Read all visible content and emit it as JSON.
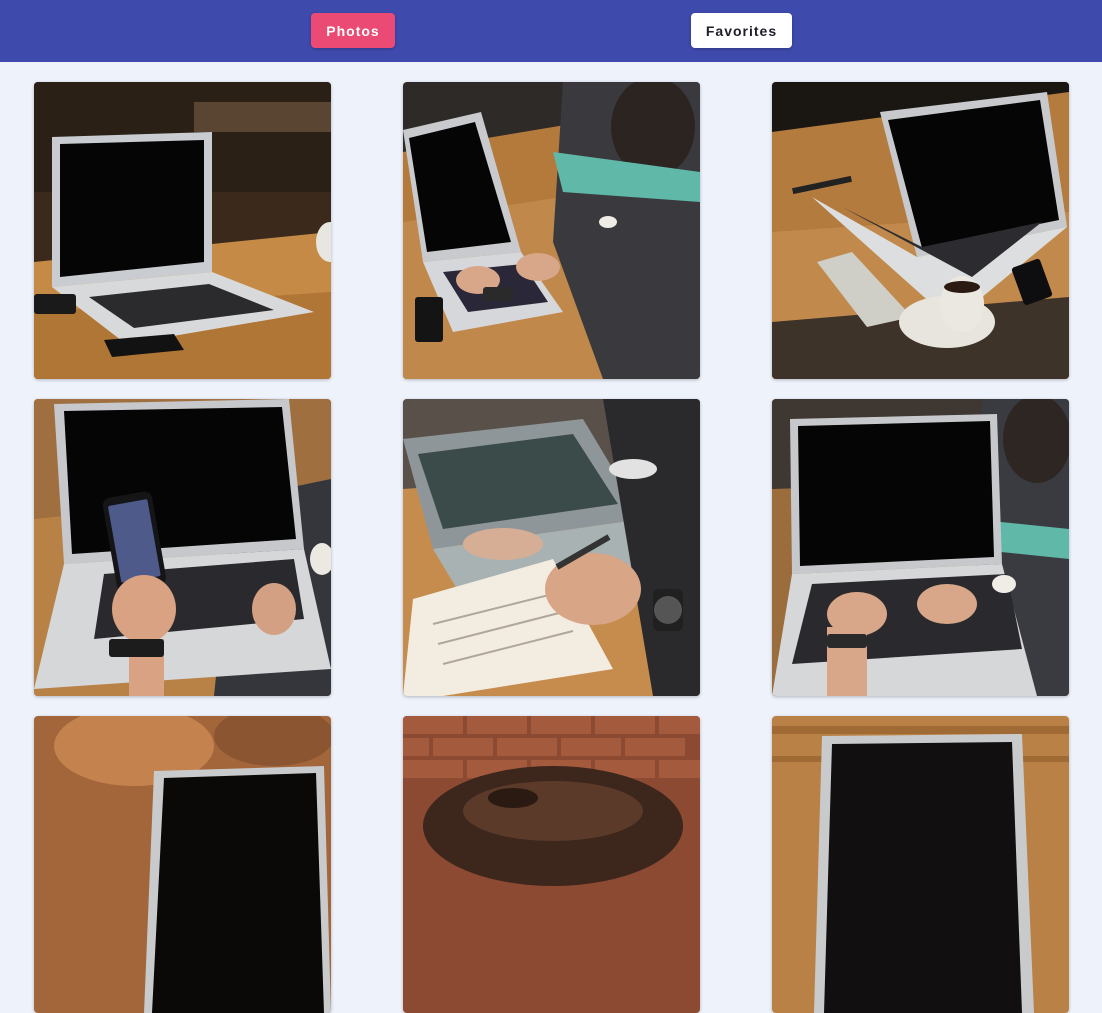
{
  "header": {
    "tabs": [
      {
        "label": "Photos",
        "active": true
      },
      {
        "label": "Favorites",
        "active": false
      }
    ]
  },
  "colors": {
    "header_bg": "#3f4aad",
    "active_tab_bg": "#ea4a73",
    "inactive_tab_bg": "#ffffff",
    "page_bg": "#eef2fb"
  },
  "gallery": {
    "photos": [
      {
        "subject": "laptop on wooden table with phone and notebook"
      },
      {
        "subject": "man typing on laptop at wooden table"
      },
      {
        "subject": "open laptop with coffee cup and notebook"
      },
      {
        "subject": "hand holding phone in front of laptop"
      },
      {
        "subject": "hand writing in notebook beside laptop"
      },
      {
        "subject": "hands typing on laptop keyboard"
      },
      {
        "subject": "laptop on blurred background"
      },
      {
        "subject": "leather bag in front of brick wall"
      },
      {
        "subject": "laptop on wooden table"
      }
    ]
  }
}
